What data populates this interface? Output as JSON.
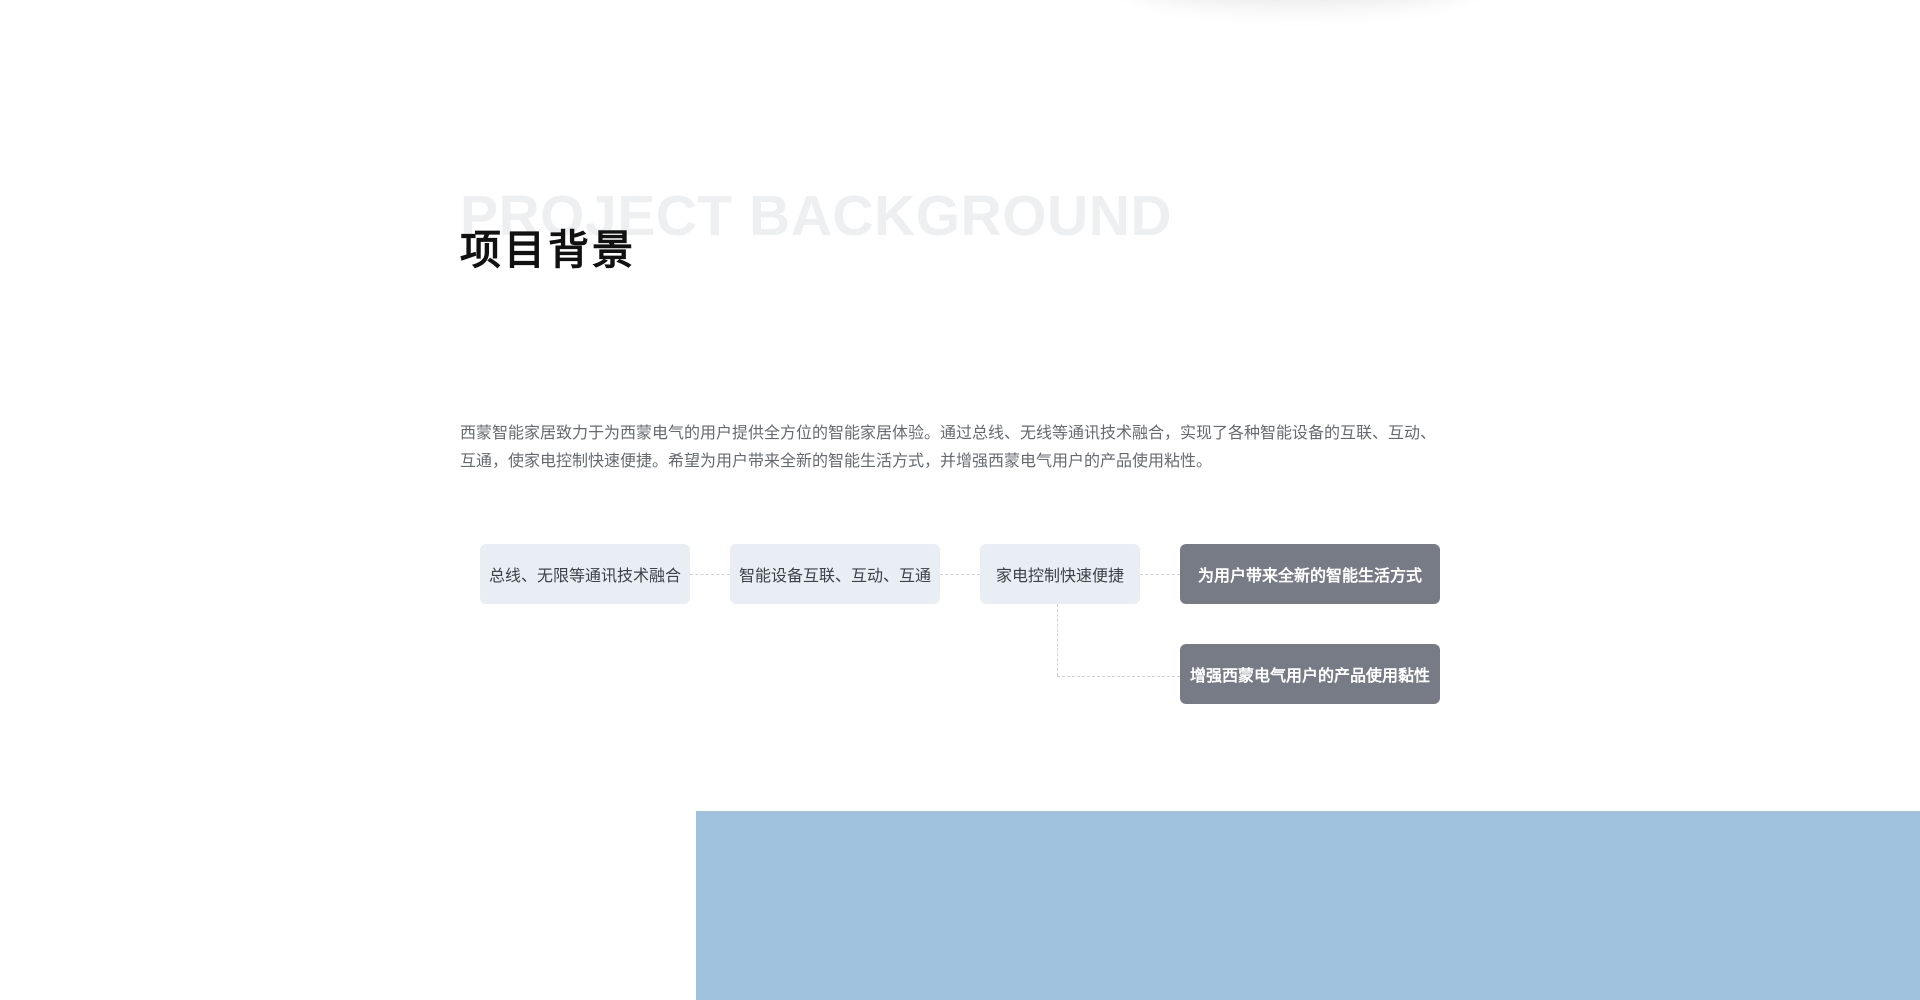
{
  "section": {
    "bg_title": "PROJECT BACKGROUND",
    "title": "项目背景",
    "description": "西蒙智能家居致力于为西蒙电气的用户提供全方位的智能家居体验。通过总线、无线等通讯技术融合，实现了各种智能设备的互联、互动、互通，使家电控制快速便捷。希望为用户带来全新的智能生活方式，并增强西蒙电气用户的产品使用粘性。"
  },
  "flow": {
    "nodes": [
      {
        "label": "总线、无限等通讯技术融合",
        "style": "light"
      },
      {
        "label": "智能设备互联、互动、互通",
        "style": "light"
      },
      {
        "label": "家电控制快速便捷",
        "style": "light"
      },
      {
        "label": "为用户带来全新的智能生活方式",
        "style": "dark"
      },
      {
        "label": "增强西蒙电气用户的产品使用黏性",
        "style": "dark"
      }
    ]
  },
  "colors": {
    "node_light_bg": "#e9eef5",
    "node_dark_bg": "#777b86",
    "accent_block": "#a1c2de",
    "title_text": "#111111",
    "body_text": "#666a70",
    "ghost_title": "#eeeff1"
  }
}
